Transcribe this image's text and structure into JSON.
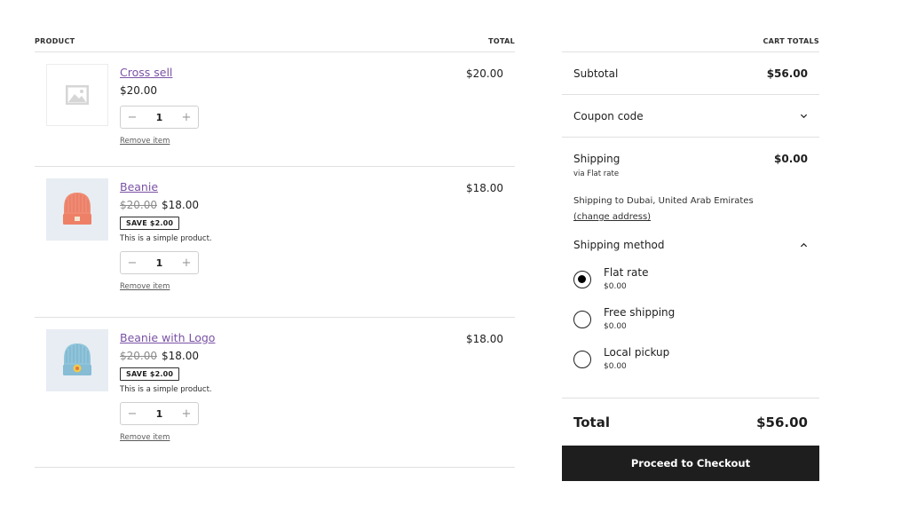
{
  "cart": {
    "header": {
      "product": "PRODUCT",
      "total": "TOTAL"
    },
    "items": [
      {
        "name": "Cross sell",
        "price": "$20.00",
        "old_price": "",
        "save_badge": "",
        "description": "",
        "quantity": "1",
        "remove_label": "Remove item",
        "line_total": "$20.00",
        "image": "placeholder-icon"
      },
      {
        "name": "Beanie",
        "price": "$18.00",
        "old_price": "$20.00",
        "save_badge": "SAVE $2.00",
        "description": "This is a simple product.",
        "quantity": "1",
        "remove_label": "Remove item",
        "line_total": "$18.00",
        "image": "orange-beanie"
      },
      {
        "name": "Beanie with Logo",
        "price": "$18.00",
        "old_price": "$20.00",
        "save_badge": "SAVE $2.00",
        "description": "This is a simple product.",
        "quantity": "1",
        "remove_label": "Remove item",
        "line_total": "$18.00",
        "image": "blue-beanie-with-logo"
      }
    ],
    "qty_minus": "−",
    "qty_plus": "+"
  },
  "totals": {
    "header": "CART TOTALS",
    "subtotal_label": "Subtotal",
    "subtotal_value": "$56.00",
    "coupon_label": "Coupon code",
    "shipping_label": "Shipping",
    "shipping_value": "$0.00",
    "shipping_via": "via Flat rate",
    "shipping_to": "Shipping to Dubai, United Arab Emirates",
    "change_address": "(change address)",
    "method_label": "Shipping method",
    "methods": [
      {
        "label": "Flat rate",
        "price": "$0.00",
        "selected": true
      },
      {
        "label": "Free shipping",
        "price": "$0.00",
        "selected": false
      },
      {
        "label": "Local pickup",
        "price": "$0.00",
        "selected": false
      }
    ],
    "total_label": "Total",
    "total_value": "$56.00",
    "checkout_label": "Proceed to Checkout"
  },
  "colors": {
    "link": "#7a52a5",
    "button_bg": "#1e1e1e",
    "divider": "#e0e0e0"
  }
}
